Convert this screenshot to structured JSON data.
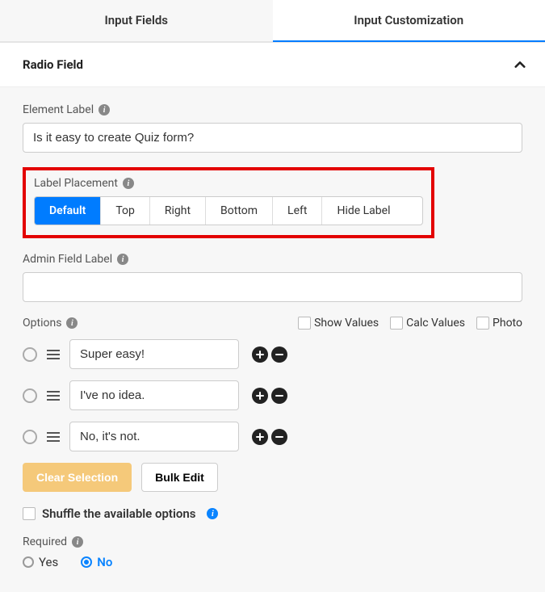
{
  "tabs": {
    "input_fields": "Input Fields",
    "input_customization": "Input Customization"
  },
  "accordion": {
    "title": "Radio Field"
  },
  "element_label": {
    "label": "Element Label",
    "value": "Is it easy to create Quiz form?"
  },
  "label_placement": {
    "label": "Label Placement",
    "options": [
      "Default",
      "Top",
      "Right",
      "Bottom",
      "Left",
      "Hide Label"
    ],
    "active": "Default"
  },
  "admin_field_label": {
    "label": "Admin Field Label",
    "value": ""
  },
  "options_section": {
    "label": "Options",
    "toggles": {
      "show_values": "Show Values",
      "calc_values": "Calc Values",
      "photo": "Photo"
    },
    "items": [
      {
        "value": "Super easy!"
      },
      {
        "value": "I've no idea."
      },
      {
        "value": "No, it's not."
      }
    ],
    "clear_selection": "Clear Selection",
    "bulk_edit": "Bulk Edit"
  },
  "shuffle": {
    "label": "Shuffle the available options"
  },
  "required": {
    "label": "Required",
    "yes": "Yes",
    "no": "No",
    "selected": "No"
  }
}
